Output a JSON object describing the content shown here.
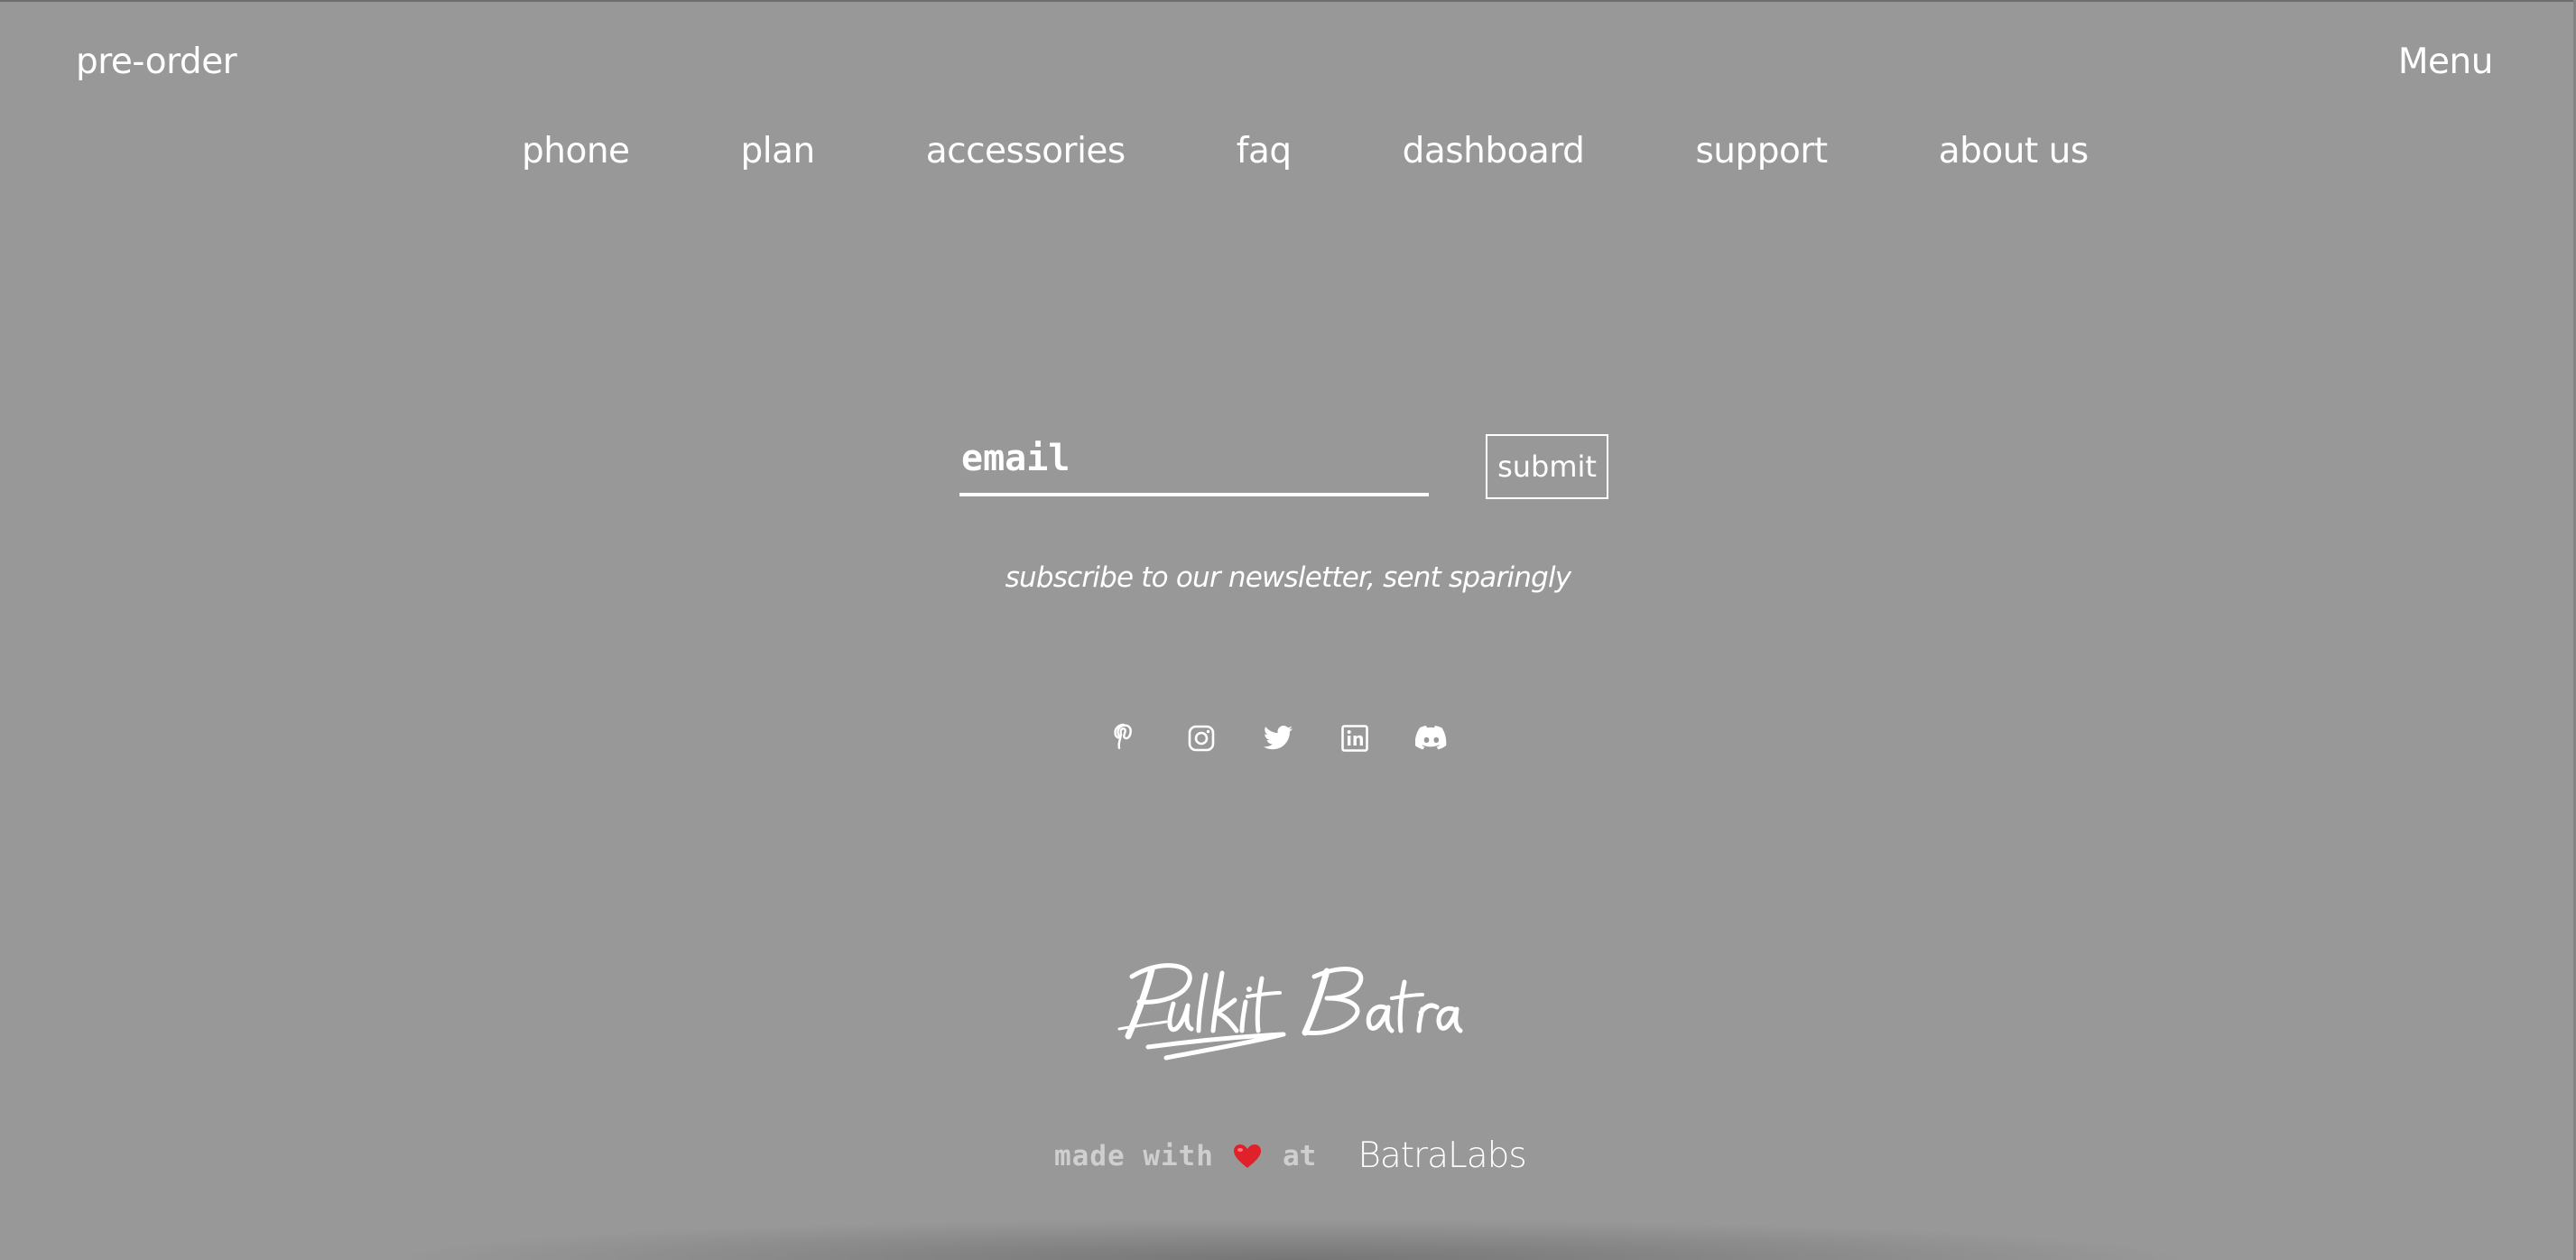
{
  "header": {
    "preorder_label": "pre-order",
    "menu_label": "Menu"
  },
  "nav": {
    "items": [
      {
        "label": "phone"
      },
      {
        "label": "plan"
      },
      {
        "label": "accessories"
      },
      {
        "label": "faq"
      },
      {
        "label": "dashboard"
      },
      {
        "label": "support"
      },
      {
        "label": "about us"
      }
    ]
  },
  "newsletter": {
    "email_placeholder": "email",
    "email_value": "",
    "submit_label": "submit",
    "caption": "subscribe to our newsletter, sent sparingly"
  },
  "socials": {
    "icons": [
      "pinterest-icon",
      "instagram-icon",
      "twitter-icon",
      "linkedin-icon",
      "discord-icon"
    ]
  },
  "footer": {
    "signature_text": "Pulkit Batra",
    "made_with": "made with",
    "heart_icon": "heart-icon",
    "at": "at",
    "brand": "BatraLabs"
  },
  "colors": {
    "background": "#989898",
    "text": "#ffffff",
    "muted_text": "#cfcfcf",
    "heart": "#e0202a"
  }
}
